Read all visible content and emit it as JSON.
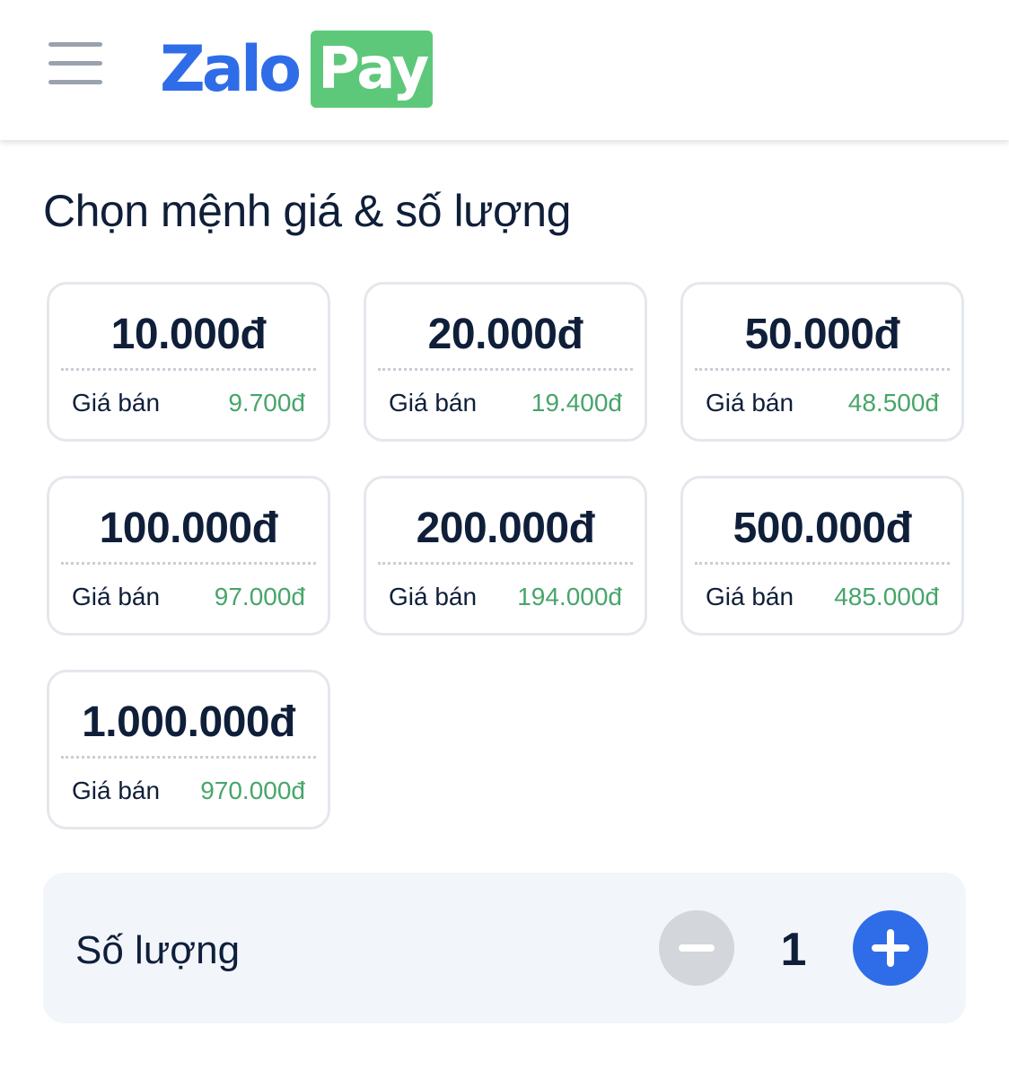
{
  "header": {
    "menu_icon": "hamburger-menu-icon",
    "logo_left": "Zalo",
    "logo_right": "Pay",
    "brand_blue": "#2f6de8",
    "brand_green": "#5ec87a"
  },
  "title": "Chọn mệnh giá & số lượng",
  "denominations": [
    {
      "value": "10.000đ",
      "label": "Giá bán",
      "price": "9.700đ"
    },
    {
      "value": "20.000đ",
      "label": "Giá bán",
      "price": "19.400đ"
    },
    {
      "value": "50.000đ",
      "label": "Giá bán",
      "price": "48.500đ"
    },
    {
      "value": "100.000đ",
      "label": "Giá bán",
      "price": "97.000đ"
    },
    {
      "value": "200.000đ",
      "label": "Giá bán",
      "price": "194.000đ"
    },
    {
      "value": "500.000đ",
      "label": "Giá bán",
      "price": "485.000đ"
    },
    {
      "value": "1.000.000đ",
      "label": "Giá bán",
      "price": "970.000đ"
    }
  ],
  "quantity": {
    "label": "Số lượng",
    "value": "1",
    "minus_icon": "minus-icon",
    "plus_icon": "plus-icon",
    "price_color": "#47a56a"
  }
}
